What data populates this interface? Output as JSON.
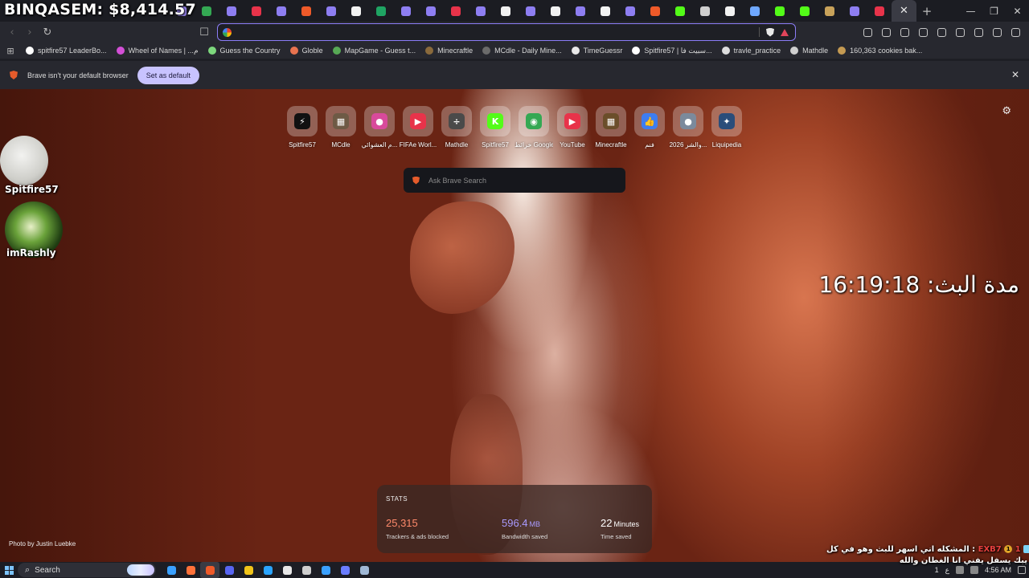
{
  "overlay": {
    "money": "BINQASEM: $8,414.57",
    "streamers": [
      {
        "name": "Spitfire57"
      },
      {
        "name": "imRashly"
      }
    ],
    "timer": "مدة البث: 16:19:18",
    "chat": {
      "line1_text": "المشكله اني اسهر للبث وهو في كل :",
      "user": "EXB7",
      "badge_count": "1",
      "line2": "يبك يسفل يفني انا الغطان والله"
    }
  },
  "tabs": {
    "favicons": [
      {
        "color": "#9b87f5",
        "icon": "perplexity-icon"
      },
      {
        "color": "#34a853",
        "icon": "sheets-icon"
      },
      {
        "color": "#8e7ef2",
        "icon": "perplexity-icon"
      },
      {
        "color": "#e8334a",
        "icon": "youtube-icon"
      },
      {
        "color": "#8e7ef2",
        "icon": "perplexity-icon"
      },
      {
        "color": "#ef5a29",
        "icon": "brave-icon"
      },
      {
        "color": "#8e7ef2",
        "icon": "perplexity-icon"
      },
      {
        "color": "#f2f2f2",
        "icon": "spark-icon"
      },
      {
        "color": "#1fa463",
        "icon": "sheets-icon"
      },
      {
        "color": "#8e7ef2",
        "icon": "perplexity-icon"
      },
      {
        "color": "#8e7ef2",
        "icon": "perplexity-icon"
      },
      {
        "color": "#e8334a",
        "icon": "youtube-icon"
      },
      {
        "color": "#8e7ef2",
        "icon": "perplexity-icon"
      },
      {
        "color": "#f1f1f1",
        "icon": "google-icon"
      },
      {
        "color": "#8e7ef2",
        "icon": "perplexity-icon"
      },
      {
        "color": "#f1f1f1",
        "icon": "google-icon"
      },
      {
        "color": "#8e7ef2",
        "icon": "perplexity-icon"
      },
      {
        "color": "#f2f2f2",
        "icon": "spark-icon"
      },
      {
        "color": "#8e7ef2",
        "icon": "perplexity-icon"
      },
      {
        "color": "#ef5a29",
        "icon": "brave-icon"
      },
      {
        "color": "#53fc18",
        "icon": "kick-icon"
      },
      {
        "color": "#cfcfcf",
        "icon": "chatgpt-icon"
      },
      {
        "color": "#f2f2f2",
        "icon": "spark-icon"
      },
      {
        "color": "#6fa8ff",
        "icon": "anchor-icon"
      },
      {
        "color": "#53fc18",
        "icon": "kick-icon"
      },
      {
        "color": "#53fc18",
        "icon": "kick-icon"
      },
      {
        "color": "#c8a25a",
        "icon": "cookie-icon"
      },
      {
        "color": "#8e7ef2",
        "icon": "perplexity-icon"
      },
      {
        "color": "#e8334a",
        "icon": "youtube-icon"
      }
    ],
    "new_tab_symbol": "+",
    "close_symbol": "✕"
  },
  "window_controls": {
    "minimize": "—",
    "maximize": "❐",
    "close": "✕"
  },
  "toolbar": {
    "back": "‹",
    "forward": "›",
    "reload": "↻",
    "bookmark": "☐",
    "address_value": "",
    "right_icons": [
      "puzzle-icon",
      "screenshot-icon",
      "music-icon",
      "sidebar-icon",
      "wallet-icon",
      "download-icon",
      "leo-icon",
      "vpn-icon",
      "menu-icon"
    ]
  },
  "bookmarks": {
    "apps_symbol": "⊞",
    "items": [
      {
        "label": "spitfire57 LeaderBo...",
        "color": "#ffffff"
      },
      {
        "label": "Wheel of Names | ...م",
        "color": "#d34fd6"
      },
      {
        "label": "Guess the Country",
        "color": "#7dd87d"
      },
      {
        "label": "Globle",
        "color": "#e8734f"
      },
      {
        "label": "MapGame - Guess t...",
        "color": "#57a955"
      },
      {
        "label": "Minecraftle",
        "color": "#8a6a3c"
      },
      {
        "label": "MCdle - Daily Mine...",
        "color": "#6b6b6b"
      },
      {
        "label": "TimeGuessr",
        "color": "#e8e8e8"
      },
      {
        "label": "Spitfire57 | سبيت فا...",
        "color": "#ffffff"
      },
      {
        "label": "travle_practice",
        "color": "#dddddd"
      },
      {
        "label": "Mathdle",
        "color": "#cfcfcf"
      },
      {
        "label": "160,363 cookies bak...",
        "color": "#c49a52"
      }
    ]
  },
  "infobar": {
    "message": "Brave isn't your default browser",
    "button": "Set as default",
    "close": "✕"
  },
  "ntp": {
    "settings_icon": "⚙",
    "top_sites": [
      {
        "label": "Spitfire57",
        "color": "#111111",
        "glyph": "⚡"
      },
      {
        "label": "MCdle",
        "color": "#6e5a45",
        "glyph": "▦"
      },
      {
        "label": "م العشوائي...",
        "color": "#d84a9b",
        "glyph": "●"
      },
      {
        "label": "FIFAe Worl...",
        "color": "#e8334a",
        "glyph": "▶"
      },
      {
        "label": "Mathdle",
        "color": "#4a4a4a",
        "glyph": "÷"
      },
      {
        "label": "Spitfire57",
        "color": "#53fc18",
        "glyph": "K"
      },
      {
        "label": "خرائط Google",
        "color": "#34a853",
        "glyph": "◉"
      },
      {
        "label": "YouTube",
        "color": "#e8334a",
        "glyph": "▶"
      },
      {
        "label": "Minecraftle",
        "color": "#6b4e2a",
        "glyph": "▦"
      },
      {
        "label": "فنم",
        "color": "#3d7df0",
        "glyph": "👍"
      },
      {
        "label": "2026 والشر...",
        "color": "#7b8a9c",
        "glyph": "●"
      },
      {
        "label": "Liquipedia",
        "color": "#2a4d7a",
        "glyph": "✦"
      }
    ],
    "search_placeholder": "Ask Brave Search",
    "photo_credit": "Photo by Justin Luebke",
    "stats": {
      "title": "STATS",
      "trackers": {
        "value": "25,315",
        "caption": "Trackers & ads blocked",
        "color": "#ff8a6b"
      },
      "bandwidth": {
        "value": "596.4",
        "unit": "MB",
        "caption": "Bandwidth saved",
        "color": "#a99bff"
      },
      "time": {
        "value": "22",
        "unit": "Minutes",
        "caption": "Time saved",
        "color": "#ffffff"
      }
    }
  },
  "taskbar": {
    "search_label": "Search",
    "apps": [
      {
        "color": "#3aa0ff",
        "icon": "copilot-icon"
      },
      {
        "color": "#ff7139",
        "icon": "firefox-icon"
      },
      {
        "color": "#ef5a29",
        "icon": "brave-icon",
        "active": true
      },
      {
        "color": "#5865f2",
        "icon": "discord-icon"
      },
      {
        "color": "#f0c419",
        "icon": "folder-icon"
      },
      {
        "color": "#2aa4ff",
        "icon": "vscode-icon"
      },
      {
        "color": "#e8e8e8",
        "icon": "app-icon"
      },
      {
        "color": "#cfcfcf",
        "icon": "obs-icon"
      },
      {
        "color": "#3aa0ff",
        "icon": "edge-icon"
      },
      {
        "color": "#6a7dff",
        "icon": "app-icon"
      },
      {
        "color": "#9fb8d6",
        "icon": "steam-icon"
      }
    ],
    "tray_number": "1",
    "lang": "ع",
    "clock": "4:56 AM"
  }
}
